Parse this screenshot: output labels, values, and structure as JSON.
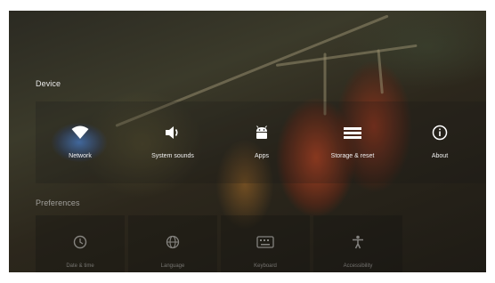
{
  "sections": {
    "device_title": "Device",
    "preferences_title": "Preferences"
  },
  "device_items": [
    {
      "label": "Network",
      "icon": "wifi-icon",
      "selected": true
    },
    {
      "label": "System sounds",
      "icon": "speaker-icon"
    },
    {
      "label": "Apps",
      "icon": "android-icon"
    },
    {
      "label": "Storage & reset",
      "icon": "storage-icon"
    },
    {
      "label": "About",
      "icon": "info-icon"
    }
  ],
  "preference_items": [
    {
      "label": "Date & time",
      "icon": "clock-icon"
    },
    {
      "label": "Language",
      "icon": "globe-icon"
    },
    {
      "label": "Keyboard",
      "icon": "keyboard-icon"
    },
    {
      "label": "Accessibility",
      "icon": "accessibility-icon"
    }
  ],
  "colors": {
    "selected_glow": "#4f96ff",
    "text": "#f2f2f2"
  }
}
